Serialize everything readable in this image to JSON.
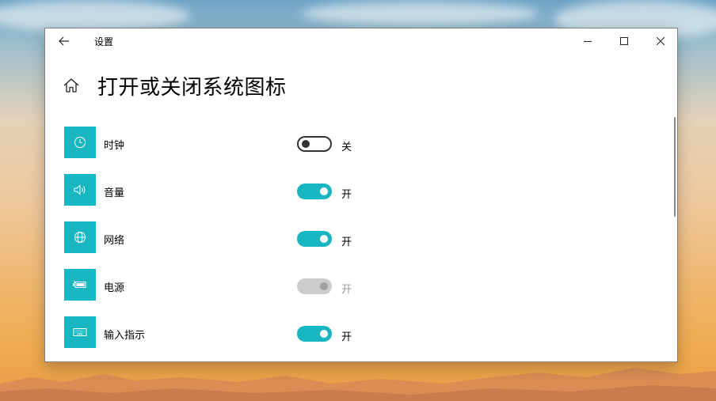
{
  "window": {
    "app_title": "设置",
    "page_title": "打开或关闭系统图标"
  },
  "items": [
    {
      "label": "时钟",
      "state": "关",
      "on": false,
      "disabled": false,
      "icon": "clock-icon"
    },
    {
      "label": "音量",
      "state": "开",
      "on": true,
      "disabled": false,
      "icon": "volume-icon"
    },
    {
      "label": "网络",
      "state": "开",
      "on": true,
      "disabled": false,
      "icon": "globe-icon"
    },
    {
      "label": "电源",
      "state": "开",
      "on": true,
      "disabled": true,
      "icon": "battery-icon"
    },
    {
      "label": "输入指示",
      "state": "开",
      "on": true,
      "disabled": false,
      "icon": "keyboard-icon"
    }
  ],
  "colors": {
    "accent": "#17b6c0",
    "toggle_disabled": "#cccccc",
    "window_bg": "#ffffff"
  }
}
